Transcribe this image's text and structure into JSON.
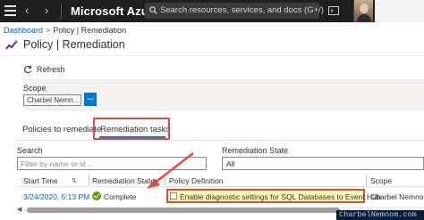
{
  "topbar": {
    "brand": "Microsoft Azure",
    "search_placeholder": "Search resources, services, and docs (G+/)"
  },
  "breadcrumb": {
    "root": "Dashboard",
    "separator": ">",
    "current": "Policy | Remediation"
  },
  "page": {
    "title": "Policy | Remediation"
  },
  "commands": {
    "refresh": "Refresh"
  },
  "scope": {
    "label": "Scope",
    "value": "Charbel Nemn...",
    "button": "..."
  },
  "tabs": [
    {
      "label": "Policies to remediate",
      "active": false
    },
    {
      "label": "Remediation tasks",
      "active": true
    }
  ],
  "filters": {
    "search_label": "Search",
    "search_placeholder": "Filter by name or id...",
    "state_label": "Remediation State",
    "state_value": "All"
  },
  "table": {
    "columns": [
      "Start Time",
      "Remediation State",
      "Policy Definition",
      "Scope"
    ],
    "rows": [
      {
        "start_time": "3/24/2020, 5:13 PM",
        "state": "Complete",
        "policy": "Enable diagnostic settings for SQL Databases to Event Hub",
        "scope": "Charbel Nemnom"
      }
    ]
  },
  "watermark": "CharbelNemnom.com",
  "colors": {
    "topbar": "#1f1f1f",
    "accent": "#0078d4",
    "highlight_border": "#e04a3f",
    "highlight_fill": "#fffbb5",
    "success": "#57a300"
  }
}
